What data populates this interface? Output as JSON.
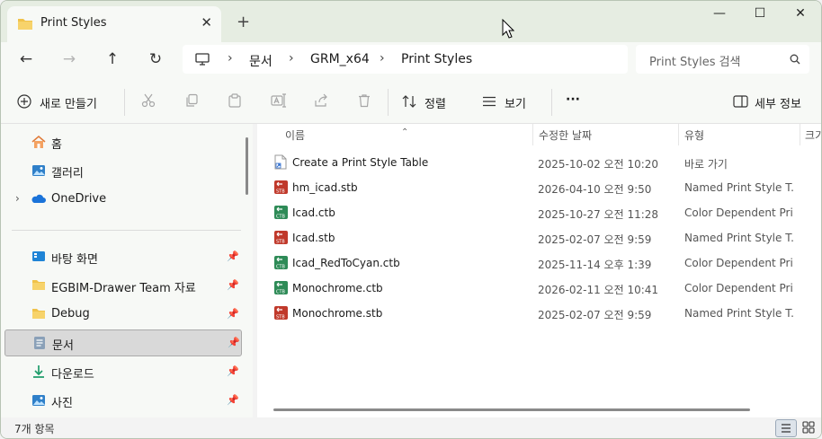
{
  "tab": {
    "title": "Print Styles",
    "close": "✕",
    "new": "+"
  },
  "window": {
    "minimize": "—",
    "maximize": "☐",
    "close": "✕"
  },
  "nav": {
    "back": "←",
    "forward": "→",
    "up": "↑",
    "refresh": "↻"
  },
  "breadcrumb": [
    "문서",
    "GRM_x64",
    "Print Styles"
  ],
  "search": {
    "placeholder": "Print Styles 검색"
  },
  "toolbar": {
    "new_label": "새로 만들기",
    "sort_label": "정렬",
    "view_label": "보기",
    "more_label": "···",
    "details_label": "세부 정보"
  },
  "sidebar": {
    "top": [
      {
        "label": "홈",
        "icon": "home-icon"
      },
      {
        "label": "갤러리",
        "icon": "gallery-icon"
      },
      {
        "label": "OneDrive",
        "icon": "onedrive-icon"
      }
    ],
    "quick": [
      {
        "label": "바탕 화면",
        "icon": "desktop-icon"
      },
      {
        "label": "EGBIM-Drawer Team 자료",
        "icon": "folder-icon"
      },
      {
        "label": "Debug",
        "icon": "folder-icon"
      },
      {
        "label": "문서",
        "icon": "documents-icon"
      },
      {
        "label": "다운로드",
        "icon": "download-icon"
      },
      {
        "label": "사진",
        "icon": "pictures-icon"
      }
    ]
  },
  "columns": {
    "name": "이름",
    "date": "수정한 날짜",
    "type": "유형",
    "size": "크기"
  },
  "files": [
    {
      "name": "Create a Print Style Table",
      "date": "2025-10-02 오전 10:20",
      "type": "바로 가기",
      "icon": "shortcut-icon"
    },
    {
      "name": "hm_icad.stb",
      "date": "2026-04-10 오전 9:50",
      "type": "Named Print Style T...",
      "icon": "stb-icon"
    },
    {
      "name": "Icad.ctb",
      "date": "2025-10-27 오전 11:28",
      "type": "Color Dependent Pri...",
      "icon": "ctb-icon"
    },
    {
      "name": "Icad.stb",
      "date": "2025-02-07 오전 9:59",
      "type": "Named Print Style T...",
      "icon": "stb-icon"
    },
    {
      "name": "Icad_RedToCyan.ctb",
      "date": "2025-11-14 오후 1:39",
      "type": "Color Dependent Pri...",
      "icon": "ctb-icon"
    },
    {
      "name": "Monochrome.ctb",
      "date": "2026-02-11 오전 10:41",
      "type": "Color Dependent Pri...",
      "icon": "ctb-icon"
    },
    {
      "name": "Monochrome.stb",
      "date": "2025-02-07 오전 9:59",
      "type": "Named Print Style T...",
      "icon": "stb-icon"
    }
  ],
  "status": {
    "count": "7개 항목"
  },
  "colors": {
    "titlebar": "#e6ede2",
    "stb": "#c0392b",
    "ctb": "#2e8b57",
    "folder": "#f0c24a"
  }
}
